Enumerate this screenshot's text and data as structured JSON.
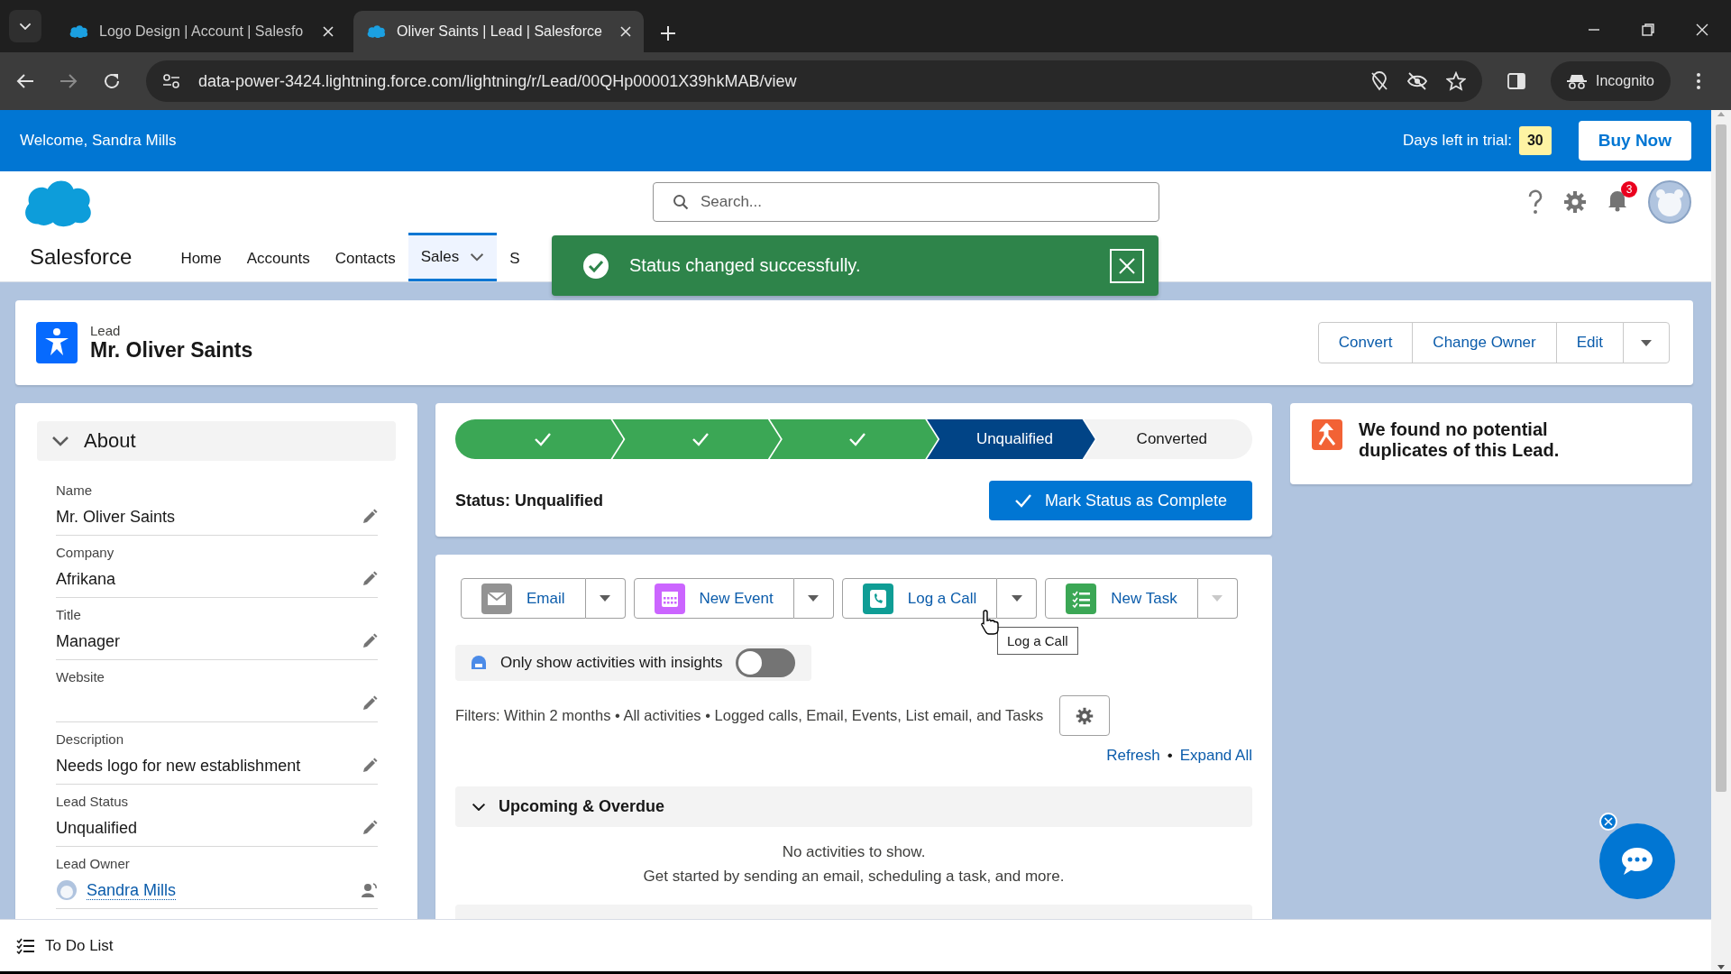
{
  "browser": {
    "tabs": [
      {
        "title": "Logo Design | Account | Salesfo",
        "selected": false
      },
      {
        "title": "Oliver Saints | Lead | Salesforce",
        "selected": true
      }
    ],
    "url": "data-power-3424.lightning.force.com/lightning/r/Lead/00QHp00001X39hkMAB/view",
    "profile": "Incognito"
  },
  "trial_bar": {
    "welcome": "Welcome, Sandra Mills",
    "trial_label": "Days left in trial:",
    "days": "30",
    "buy_button": "Buy Now"
  },
  "header": {
    "search": {
      "placeholder": "Search..."
    },
    "notification_count": "3",
    "app_name": "Salesforce",
    "nav": [
      {
        "label": "Home",
        "selected": false,
        "menu": false
      },
      {
        "label": "Accounts",
        "selected": false,
        "menu": false
      },
      {
        "label": "Contacts",
        "selected": false,
        "menu": false
      },
      {
        "label": "Sales",
        "selected": true,
        "menu": true
      },
      {
        "label": "S",
        "selected": false,
        "menu": false
      }
    ]
  },
  "toast": {
    "message": "Status changed successfully."
  },
  "record": {
    "object": "Lead",
    "name": "Mr. Oliver Saints",
    "actions": [
      "Convert",
      "Change Owner",
      "Edit"
    ]
  },
  "about": {
    "title": "About",
    "expanded": true,
    "fields": [
      {
        "label": "Name",
        "value": "Mr. Oliver Saints",
        "kind": "text"
      },
      {
        "label": "Company",
        "value": "Afrikana",
        "kind": "text"
      },
      {
        "label": "Title",
        "value": "Manager",
        "kind": "text"
      },
      {
        "label": "Website",
        "kind": "text"
      },
      {
        "label": "Description",
        "value": "Needs logo for new establishment",
        "kind": "text"
      },
      {
        "label": "Lead Status",
        "value": "Unqualified",
        "kind": "text"
      },
      {
        "label": "Lead Owner",
        "value": "Sandra Mills",
        "kind": "user"
      }
    ]
  },
  "path": {
    "stages": [
      {
        "completed": true,
        "selected": false
      },
      {
        "completed": true,
        "selected": false
      },
      {
        "completed": true,
        "selected": false
      },
      {
        "label": "Unqualified",
        "completed": false,
        "selected": true
      },
      {
        "label": "Converted",
        "completed": false,
        "selected": false
      }
    ],
    "status_text": "Status: Unqualified",
    "button": "Mark Status as Complete"
  },
  "activity": {
    "actions": [
      {
        "label": "Email",
        "kind": "email",
        "color": "#939393",
        "menu_disabled": false
      },
      {
        "label": "New Event",
        "kind": "event",
        "color": "#cb65ff",
        "menu_disabled": false
      },
      {
        "label": "Log a Call",
        "kind": "call",
        "color": "#0f9d95",
        "menu_disabled": false
      },
      {
        "label": "New Task",
        "kind": "task",
        "color": "#3ba755",
        "menu_disabled": true
      }
    ],
    "tooltip": "Log a Call",
    "insights": {
      "label": "Only show activities with insights",
      "on": false
    },
    "filters": "Filters: Within 2 months • All activities • Logged calls, Email, Events, List email, and Tasks",
    "links": [
      "Refresh",
      "Expand All"
    ],
    "link_separator": "•",
    "section": {
      "title": "Upcoming & Overdue",
      "expanded": true,
      "empty": [
        "No activities to show.",
        "Get started by sending an email, scheduling a task, and more."
      ]
    }
  },
  "duplicates": {
    "message": "We found no potential duplicates of this Lead."
  },
  "todo": {
    "label": "To Do List"
  }
}
